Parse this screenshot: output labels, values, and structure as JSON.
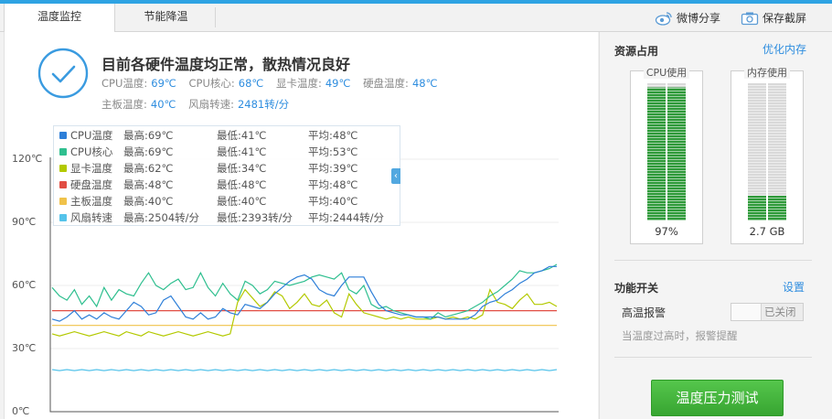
{
  "tabs": [
    {
      "label": "温度监控",
      "active": true
    },
    {
      "label": "节能降温",
      "active": false
    }
  ],
  "toolbar": {
    "weibo_share": "微博分享",
    "save_screenshot": "保存截屏"
  },
  "status": {
    "title": "目前各硬件温度均正常，散热情况良好",
    "items": [
      {
        "label": "CPU温度:",
        "value": "69℃"
      },
      {
        "label": "CPU核心:",
        "value": "68℃"
      },
      {
        "label": "显卡温度:",
        "value": "49℃"
      },
      {
        "label": "硬盘温度:",
        "value": "48℃"
      },
      {
        "label": "主板温度:",
        "value": "40℃"
      },
      {
        "label": "风扇转速:",
        "value": "2481转/分"
      }
    ]
  },
  "chart_data": {
    "type": "line",
    "y_ticks": [
      "120℃",
      "90℃",
      "60℃",
      "30℃",
      "0℃"
    ],
    "ylim": [
      0,
      120
    ],
    "grid": true,
    "legend_position": "top-left",
    "series": [
      {
        "name": "CPU温度",
        "color": "#2e7fd8",
        "max": "最高:69℃",
        "min": "最低:41℃",
        "avg": "平均:48℃",
        "values": [
          44,
          43,
          45,
          48,
          44,
          46,
          44,
          47,
          45,
          44,
          48,
          52,
          50,
          46,
          47,
          53,
          55,
          50,
          45,
          44,
          47,
          44,
          45,
          49,
          47,
          46,
          51,
          50,
          49,
          52,
          56,
          59,
          62,
          64,
          65,
          63,
          58,
          56,
          55,
          60,
          64,
          64,
          64,
          57,
          51,
          48,
          47,
          46,
          46,
          45,
          45,
          45,
          45,
          44,
          44,
          44,
          44,
          46,
          50,
          52,
          53,
          56,
          58,
          61,
          63,
          66,
          67,
          69,
          69
        ]
      },
      {
        "name": "CPU核心",
        "color": "#2fbf8f",
        "max": "最高:69℃",
        "min": "最低:41℃",
        "avg": "平均:53℃",
        "values": [
          59,
          55,
          53,
          58,
          51,
          55,
          50,
          59,
          53,
          58,
          56,
          55,
          61,
          66,
          60,
          58,
          61,
          63,
          58,
          59,
          66,
          59,
          55,
          61,
          56,
          53,
          62,
          60,
          56,
          58,
          62,
          61,
          60,
          61,
          62,
          64,
          65,
          64,
          63,
          66,
          58,
          56,
          60,
          51,
          49,
          50,
          48,
          47,
          46,
          45,
          45,
          44,
          47,
          45,
          46,
          47,
          48,
          50,
          52,
          55,
          57,
          60,
          63,
          67,
          66,
          66,
          67,
          68,
          70
        ]
      },
      {
        "name": "显卡温度",
        "color": "#b3c900",
        "max": "最高:62℃",
        "min": "最低:34℃",
        "avg": "平均:39℃",
        "values": [
          37,
          36,
          37,
          38,
          37,
          36,
          37,
          38,
          37,
          36,
          38,
          37,
          36,
          38,
          37,
          36,
          37,
          38,
          37,
          36,
          37,
          38,
          37,
          36,
          37,
          52,
          58,
          54,
          50,
          52,
          57,
          55,
          49,
          52,
          56,
          51,
          50,
          53,
          47,
          45,
          56,
          51,
          47,
          46,
          45,
          44,
          45,
          44,
          45,
          44,
          44,
          44,
          45,
          44,
          45,
          44,
          45,
          44,
          46,
          58,
          52,
          51,
          49,
          53,
          56,
          51,
          51,
          52,
          50
        ]
      },
      {
        "name": "硬盘温度",
        "color": "#e14d43",
        "max": "最高:48℃",
        "min": "最低:48℃",
        "avg": "平均:48℃",
        "values": [
          48,
          48,
          48,
          48,
          48,
          48,
          48,
          48,
          48,
          48,
          48,
          48,
          48,
          48,
          48,
          48,
          48,
          48,
          48,
          48,
          48,
          48,
          48,
          48,
          48,
          48,
          48,
          48,
          48,
          48,
          48,
          48,
          48,
          48,
          48,
          48,
          48,
          48,
          48,
          48,
          48,
          48,
          48,
          48,
          48,
          48,
          48,
          48,
          48,
          48,
          48,
          48,
          48,
          48,
          48,
          48,
          48,
          48,
          48,
          48,
          48,
          48,
          48,
          48,
          48,
          48,
          48,
          48,
          48
        ]
      },
      {
        "name": "主板温度",
        "color": "#f0c24a",
        "max": "最高:40℃",
        "min": "最低:40℃",
        "avg": "平均:40℃",
        "values": [
          41,
          41,
          41,
          41,
          41,
          41,
          41,
          41,
          41,
          41,
          41,
          41,
          41,
          41,
          41,
          41,
          41,
          41,
          41,
          41,
          41,
          41,
          41,
          41,
          41,
          41,
          41,
          41,
          41,
          41,
          41,
          41,
          41,
          41,
          41,
          41,
          41,
          41,
          41,
          41,
          41,
          41,
          41,
          41,
          41,
          41,
          41,
          41,
          41,
          41,
          41,
          41,
          41,
          41,
          41,
          41,
          41,
          41,
          41,
          41,
          41,
          41,
          41,
          41,
          41,
          41,
          41,
          41,
          41
        ]
      },
      {
        "name": "风扇转速",
        "color": "#55c3ea",
        "max": "最高:2504转/分",
        "min": "最低:2393转/分",
        "avg": "平均:2444转/分",
        "values": [
          20,
          19.5,
          20,
          19.5,
          20,
          19.5,
          20,
          19.5,
          20,
          19.5,
          20,
          19.5,
          20,
          19.5,
          20,
          19.5,
          20,
          19.5,
          20,
          19.5,
          20,
          19.5,
          20,
          19.5,
          20,
          19.5,
          20,
          19.5,
          20,
          19.5,
          20,
          19.5,
          20,
          19.5,
          20,
          19.5,
          20,
          19.5,
          20,
          19.5,
          20,
          19.5,
          20,
          19.5,
          20,
          19.5,
          20,
          19.5,
          20,
          19.5,
          20,
          19.5,
          20,
          19.5,
          20,
          19.5,
          20,
          19.5,
          20,
          19.5,
          20,
          19.5,
          20,
          19.5,
          20,
          19.5,
          20,
          19.5,
          20
        ]
      }
    ]
  },
  "resources": {
    "title": "资源占用",
    "optimize_link": "优化内存",
    "cpu": {
      "label": "CPU使用",
      "value_text": "97%",
      "fill": 0.97,
      "color": "#2f9a3a"
    },
    "memory": {
      "label": "内存使用",
      "value_text": "2.7 GB",
      "fill": 0.18,
      "color": "#2f9a3a"
    }
  },
  "features": {
    "title": "功能开关",
    "settings_link": "设置",
    "alarm_label": "高温报警",
    "alarm_state": "已关闭",
    "alarm_hint": "当温度过高时，报警提醒"
  },
  "stress_test_button": "温度压力测试"
}
